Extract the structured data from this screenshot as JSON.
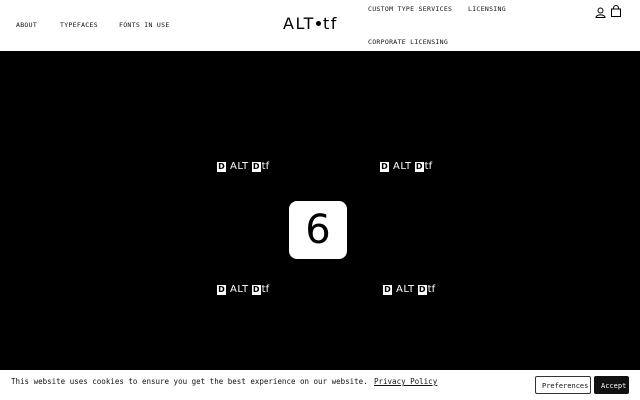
{
  "header": {
    "logo": {
      "part1": "ALT",
      "part2": "tf"
    },
    "nav_left": [
      "ABOUT",
      "TYPEFACES",
      "FONTS IN USE"
    ],
    "nav_right": [
      "CUSTOM TYPE SERVICES",
      "LICENSING",
      "CORPORATE LICENSING"
    ],
    "icons": [
      "user-icon",
      "cart-icon"
    ]
  },
  "main": {
    "badge": {
      "box_left": "D",
      "word": "ALT",
      "box_right": "D",
      "suffix": "tf"
    },
    "tile": "6"
  },
  "cookie_banner": {
    "message": "This website uses cookies to ensure you get the best experience on our website.",
    "link": "Privacy Policy",
    "preferences": "Preferences",
    "accept": "Accept"
  },
  "colors": {
    "background": "#000000",
    "foreground": "#ffffff"
  }
}
